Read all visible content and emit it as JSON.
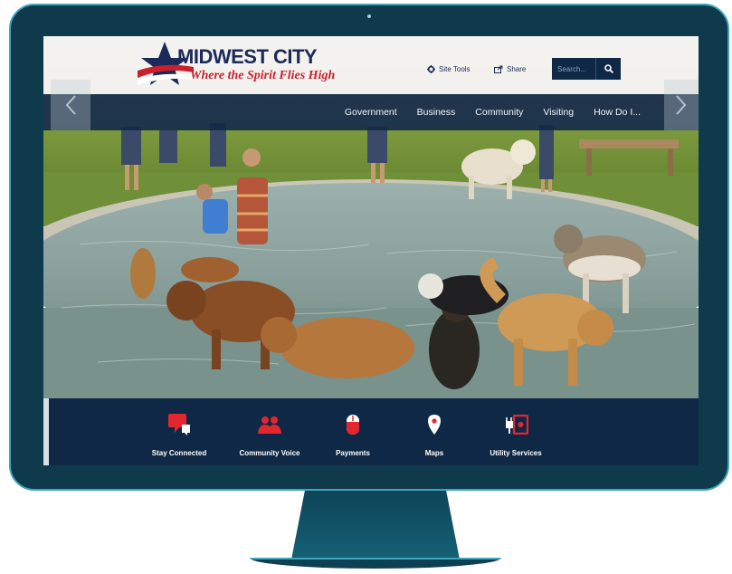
{
  "site": {
    "name": "MIDWEST CITY",
    "tagline": "Where the Spirit Flies High"
  },
  "header": {
    "site_tools_label": "Site Tools",
    "share_label": "Share",
    "search_placeholder": "Search..."
  },
  "nav": {
    "items": [
      "Government",
      "Business",
      "Community",
      "Visiting",
      "How Do I..."
    ]
  },
  "quick_links": [
    {
      "label": "Stay Connected",
      "icon": "speech-bubble-icon"
    },
    {
      "label": "Community Voice",
      "icon": "people-icon"
    },
    {
      "label": "Payments",
      "icon": "mouse-icon"
    },
    {
      "label": "Maps",
      "icon": "map-pin-icon"
    },
    {
      "label": "Utility Services",
      "icon": "plug-icon"
    }
  ],
  "colors": {
    "brand_navy": "#0f2846",
    "brand_red": "#c8202d",
    "monitor": "#0e3a4c",
    "monitor_edge": "#3fa5b8"
  }
}
